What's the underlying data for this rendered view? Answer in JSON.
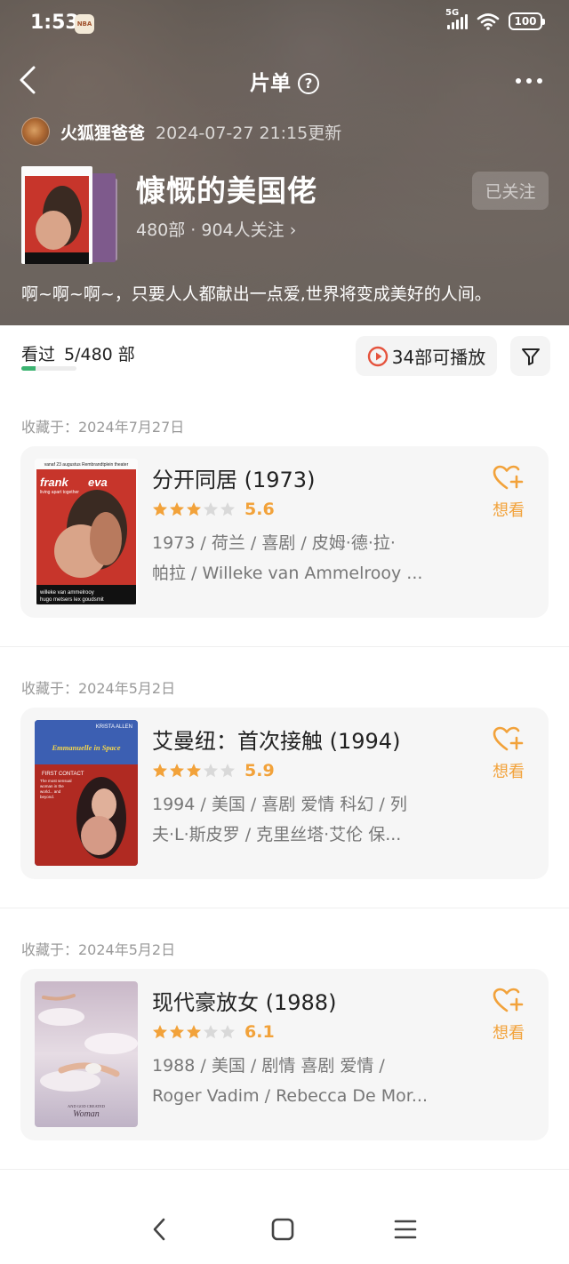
{
  "status_bar": {
    "time": "1:53",
    "app_badge": "NBA",
    "network": "5G",
    "battery": "100"
  },
  "nav": {
    "title": "片单",
    "help_glyph": "?"
  },
  "creator": {
    "name": "火狐狸爸爸",
    "updated": "2024-07-27 21:15更新"
  },
  "list": {
    "title": "慷慨的美国佬",
    "meta": "480部 · 904人关注 ›",
    "follow_label": "已关注",
    "description": "啊~啊~啊~，只要人人都献出一点爱,世界将变成美好的人间。"
  },
  "toolbar": {
    "seen_label": "看过",
    "seen_count": "5/480 部",
    "seen_progress": 0.0104,
    "playable_label": "34部可播放"
  },
  "sections": [
    {
      "date": "收藏于：2024年7月27日",
      "movie": {
        "title": "分开同居 (1973)",
        "stars": 3,
        "score": "5.6",
        "meta_line1": "1973 / 荷兰 / 喜剧 / 皮姆·德·拉·",
        "meta_line2": "帕拉 / Willeke van Ammelrooy ...",
        "want_label": "想看",
        "poster_text": {
          "top": "vanaf 23 augustus  Rembrandtplein theater",
          "title_a": "frank",
          "title_b": "eva",
          "tagline": "living apart together",
          "credits_1": "willeke van ammelrooy",
          "credits_2": "hugo metsers  lex goudsmit"
        }
      }
    },
    {
      "date": "收藏于：2024年5月2日",
      "movie": {
        "title": "艾曼纽：首次接触 (1994)",
        "stars": 3,
        "score": "5.9",
        "meta_line1": "1994 / 美国 / 喜剧 爱情 科幻 / 列",
        "meta_line2": "夫·L·斯皮罗 / 克里丝塔·艾伦 保...",
        "want_label": "想看",
        "poster_text": {
          "top": "KRISTA ALLEN",
          "title": "Emmanuelle in Space",
          "subtitle": "FIRST CONTACT",
          "blurb": "The most sensual woman in the world... and beyond."
        }
      }
    },
    {
      "date": "收藏于：2024年5月2日",
      "movie": {
        "title": "现代豪放女 (1988)",
        "stars": 3,
        "score": "6.1",
        "meta_line1": "1988 / 美国 / 剧情 喜剧 爱情 /",
        "meta_line2": "Roger Vadim / Rebecca De Mor...",
        "want_label": "想看",
        "poster_text": {
          "title": "Woman",
          "tagline": "AND GOD CREATED"
        }
      }
    }
  ],
  "colors": {
    "accent": "#f2a23a",
    "star_empty": "#d9d9d9",
    "progress": "#3cb371",
    "play_red": "#e5533d"
  }
}
